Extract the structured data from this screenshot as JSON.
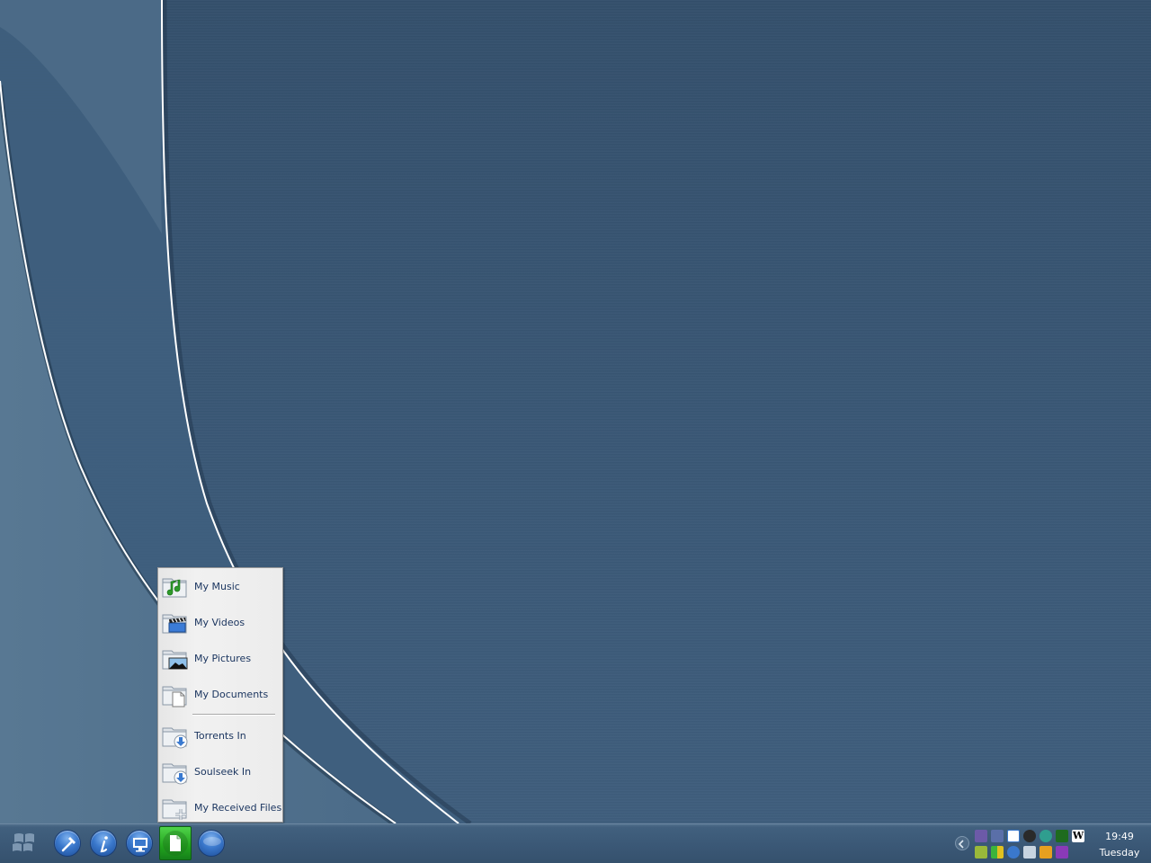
{
  "folder_menu": {
    "items": [
      {
        "label": "My Music",
        "icon": "music-folder-icon"
      },
      {
        "label": "My Videos",
        "icon": "video-folder-icon"
      },
      {
        "label": "My Pictures",
        "icon": "pictures-folder-icon"
      },
      {
        "label": "My Documents",
        "icon": "documents-folder-icon"
      },
      {
        "label": "Torrents In",
        "icon": "download-folder-icon"
      },
      {
        "label": "Soulseek In",
        "icon": "download-folder-icon"
      },
      {
        "label": "My Received Files",
        "icon": "received-folder-icon"
      }
    ]
  },
  "taskbar": {
    "buttons": [
      {
        "name": "windows-logo-icon"
      },
      {
        "name": "tools-hammer-icon"
      },
      {
        "name": "info-icon"
      },
      {
        "name": "my-computer-icon"
      },
      {
        "name": "documents-icon"
      },
      {
        "name": "browser-globe-icon"
      }
    ]
  },
  "clock": {
    "time": "19:49",
    "day": "Tuesday"
  },
  "colors": {
    "desktop": "#3a5976",
    "menu_bg": "#ececec",
    "menu_text": "#1c3660",
    "active_button": "#22a31d"
  }
}
